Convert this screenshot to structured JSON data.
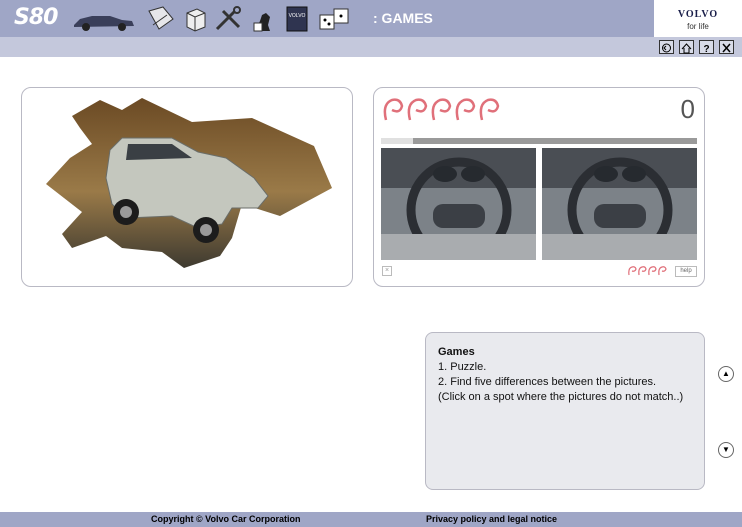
{
  "header": {
    "model": "S80",
    "section": ": GAMES",
    "brand_logo": "VOLVO",
    "brand_tagline": "for life",
    "nav_icons": [
      "car-icon",
      "manual-icon",
      "box-icon",
      "tools-icon",
      "chess-icon",
      "volvo-book-icon",
      "dice-icon"
    ]
  },
  "controls": [
    "back-icon",
    "home-icon",
    "help-icon",
    "close-icon"
  ],
  "game": {
    "score": "0",
    "progress": 0.1,
    "help_label": "help",
    "mistakes_left_icons": 5
  },
  "info": {
    "title": "Games",
    "line1": "1. Puzzle.",
    "line2": "2. Find five differences between the pictures.",
    "line3": "(Click on a spot where the pictures do not match..)"
  },
  "footer": {
    "copyright": "Copyright © Volvo Car Corporation",
    "privacy": "Privacy policy and legal notice"
  },
  "colors": {
    "header": "#9fa6c6",
    "subheader": "#c4c8dc",
    "accent": "#e0707a"
  }
}
